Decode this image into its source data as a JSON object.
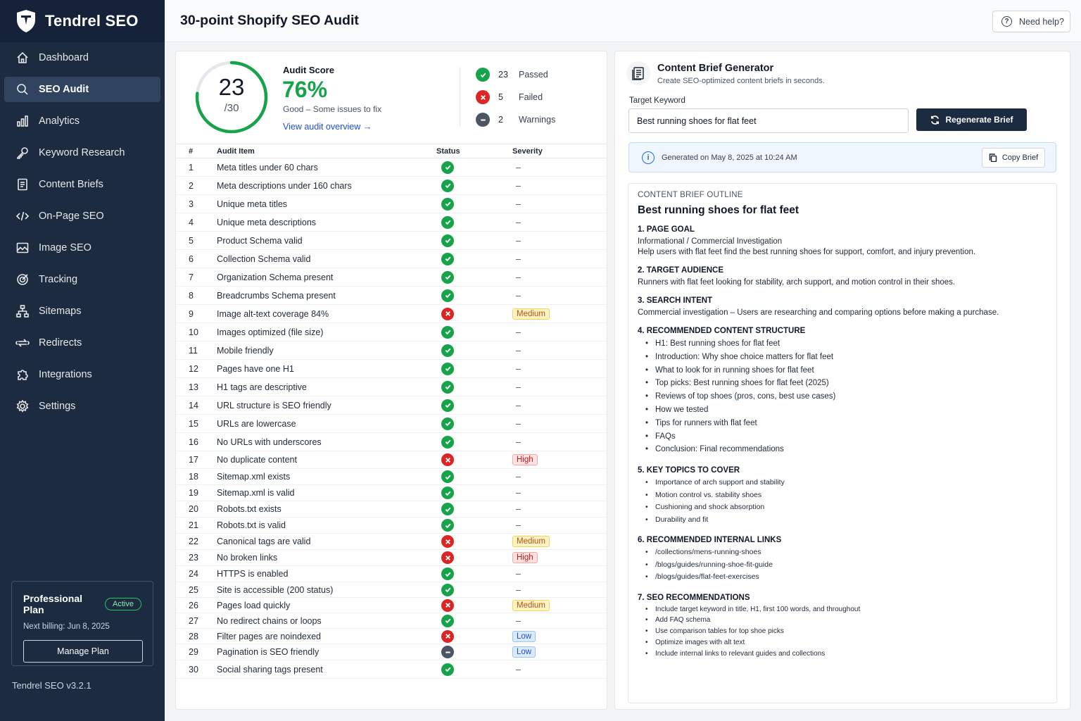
{
  "app": {
    "name": "Tendrel SEO",
    "version": "Tendrel SEO v3.2.1"
  },
  "colors": {
    "sidebar_bg": "#1c2b40",
    "pass": "#16a34a",
    "fail": "#dc2626",
    "warning": "#4b5563",
    "link": "#1d4ed8"
  },
  "sidebar": {
    "items": [
      {
        "label": "Dashboard",
        "icon": "home-icon"
      },
      {
        "label": "SEO Audit",
        "icon": "search-icon",
        "active": true
      },
      {
        "label": "Analytics",
        "icon": "bar-chart-icon"
      },
      {
        "label": "Keyword Research",
        "icon": "key-icon"
      },
      {
        "label": "Content Briefs",
        "icon": "document-icon"
      },
      {
        "label": "On-Page SEO",
        "icon": "code-icon"
      },
      {
        "label": "Image SEO",
        "icon": "image-icon"
      },
      {
        "label": "Tracking",
        "icon": "target-icon"
      },
      {
        "label": "Sitemaps",
        "icon": "sitemap-icon"
      },
      {
        "label": "Redirects",
        "icon": "redirect-icon"
      },
      {
        "label": "Integrations",
        "icon": "puzzle-icon"
      },
      {
        "label": "Settings",
        "icon": "gear-icon"
      }
    ],
    "plan": {
      "title": "Professional Plan",
      "badge": "Active",
      "billing": "Next billing: Jun 8, 2025",
      "button": "Manage Plan"
    }
  },
  "header": {
    "title": "30-point Shopify SEO Audit",
    "help": "Need help?"
  },
  "audit": {
    "score": "23",
    "score_total": "/30",
    "score_fraction": 0.7667,
    "label": "Audit Score",
    "percent": "76%",
    "summary": "Good – Some issues to fix",
    "link": "View audit overview →",
    "stats": [
      {
        "count": "23",
        "label": "Passed",
        "type": "pass"
      },
      {
        "count": "5",
        "label": "Failed",
        "type": "fail"
      },
      {
        "count": "2",
        "label": "Warnings",
        "type": "warn"
      }
    ],
    "columns": [
      "#",
      "Audit Item",
      "Status",
      "Severity"
    ],
    "rows": [
      {
        "num": "1",
        "item": "Meta titles under 60 chars",
        "status": "pass",
        "severity": "–"
      },
      {
        "num": "2",
        "item": "Meta descriptions under 160 chars",
        "status": "pass",
        "severity": "–"
      },
      {
        "num": "3",
        "item": "Unique meta titles",
        "status": "pass",
        "severity": "–"
      },
      {
        "num": "4",
        "item": "Unique meta descriptions",
        "status": "pass",
        "severity": "–"
      },
      {
        "num": "5",
        "item": "Product Schema valid",
        "status": "pass",
        "severity": "–"
      },
      {
        "num": "6",
        "item": "Collection Schema valid",
        "status": "pass",
        "severity": "–"
      },
      {
        "num": "7",
        "item": "Organization Schema present",
        "status": "pass",
        "severity": "–"
      },
      {
        "num": "8",
        "item": "Breadcrumbs Schema present",
        "status": "pass",
        "severity": "–"
      },
      {
        "num": "9",
        "item": "Image alt-text coverage  84%",
        "status": "fail",
        "severity": "Medium"
      },
      {
        "num": "10",
        "item": "Images optimized (file size)",
        "status": "pass",
        "severity": "–"
      },
      {
        "num": "11",
        "item": "Mobile friendly",
        "status": "pass",
        "severity": "–"
      },
      {
        "num": "12",
        "item": "Pages have one H1",
        "status": "pass",
        "severity": "–"
      },
      {
        "num": "13",
        "item": "H1 tags are descriptive",
        "status": "pass",
        "severity": "–"
      },
      {
        "num": "14",
        "item": "URL structure is SEO friendly",
        "status": "pass",
        "severity": "–"
      },
      {
        "num": "15",
        "item": "URLs are lowercase",
        "status": "pass",
        "severity": "–"
      },
      {
        "num": "16",
        "item": "No URLs with underscores",
        "status": "pass",
        "severity": "–"
      },
      {
        "num": "17",
        "item": "No duplicate content",
        "status": "fail",
        "severity": "High"
      },
      {
        "num": "18",
        "item": "Sitemap.xml exists",
        "status": "pass",
        "severity": "–"
      },
      {
        "num": "19",
        "item": "Sitemap.xml is valid",
        "status": "pass",
        "severity": "–"
      },
      {
        "num": "20",
        "item": "Robots.txt exists",
        "status": "pass",
        "severity": "–"
      },
      {
        "num": "21",
        "item": "Robots.txt is valid",
        "status": "pass",
        "severity": "–"
      },
      {
        "num": "22",
        "item": "Canonical tags are valid",
        "status": "fail",
        "severity": "Medium"
      },
      {
        "num": "23",
        "item": "No broken links",
        "status": "fail",
        "severity": "High"
      },
      {
        "num": "24",
        "item": "HTTPS is enabled",
        "status": "pass",
        "severity": "–"
      },
      {
        "num": "25",
        "item": "Site is accessible (200 status)",
        "status": "pass",
        "severity": "–"
      },
      {
        "num": "26",
        "item": "Pages load quickly",
        "status": "fail",
        "severity": "Medium"
      },
      {
        "num": "27",
        "item": "No redirect chains or loops",
        "status": "pass",
        "severity": "–"
      },
      {
        "num": "28",
        "item": "Filter pages are noindexed",
        "status": "fail",
        "severity": "Low"
      },
      {
        "num": "29",
        "item": "Pagination is SEO friendly",
        "status": "warn",
        "severity": "Low"
      },
      {
        "num": "30",
        "item": "Social sharing tags present",
        "status": "pass",
        "severity": "–"
      }
    ]
  },
  "brief": {
    "title": "Content Brief Generator",
    "subtitle": "Create SEO-optimized content briefs in seconds.",
    "keyword_label": "Target Keyword",
    "keyword_value": "Best running shoes for flat feet",
    "regenerate": "Regenerate Brief",
    "generated": "Generated on May 8, 2025 at 10:24 AM",
    "copy": "Copy Brief",
    "outline_kicker": "CONTENT BRIEF OUTLINE",
    "outline_title": "Best running shoes for flat feet",
    "sections": [
      {
        "heading": "1.  PAGE GOAL",
        "text": [
          "Informational / Commercial Investigation",
          "Help users with flat feet find the best running shoes for support, comfort, and injury prevention."
        ],
        "list": [],
        "size": ""
      },
      {
        "heading": "2.  TARGET AUDIENCE",
        "text": [
          "Runners with flat feet looking for stability, arch support, and motion control in their shoes."
        ],
        "list": [],
        "size": ""
      },
      {
        "heading": "3.  SEARCH INTENT",
        "text": [
          "Commercial investigation – Users are researching and comparing options before making a purchase."
        ],
        "list": [],
        "size": ""
      },
      {
        "heading": "4.  RECOMMENDED CONTENT STRUCTURE",
        "text": [],
        "list": [
          "H1: Best running shoes for flat feet",
          "Introduction: Why shoe choice matters for flat feet",
          "What to look for in running shoes for flat feet",
          "Top picks: Best running shoes for flat feet (2025)",
          "Reviews of top shoes (pros, cons, best use cases)",
          "How we tested",
          "Tips for runners with flat feet",
          "FAQs",
          "Conclusion: Final recommendations"
        ],
        "size": ""
      },
      {
        "heading": "5.  KEY TOPICS TO COVER",
        "text": [],
        "list": [
          "Importance of arch support and stability",
          "Motion control vs. stability shoes",
          "Cushioning and shock absorption",
          "Durability and fit"
        ],
        "size": "sm"
      },
      {
        "heading": "6.  RECOMMENDED INTERNAL LINKS",
        "text": [],
        "list": [
          "/collections/mens-running-shoes",
          "/blogs/guides/running-shoe-fit-guide",
          "/blogs/guides/flat-feet-exercises"
        ],
        "size": "sm"
      },
      {
        "heading": "7.  SEO RECOMMENDATIONS",
        "text": [],
        "list": [
          "Include target keyword in title, H1, first 100 words, and throughout",
          "Add FAQ schema",
          "Use comparison tables for top shoe picks",
          "Optimize images with alt text",
          "Include internal links to relevant guides and collections"
        ],
        "size": "xs"
      }
    ]
  }
}
